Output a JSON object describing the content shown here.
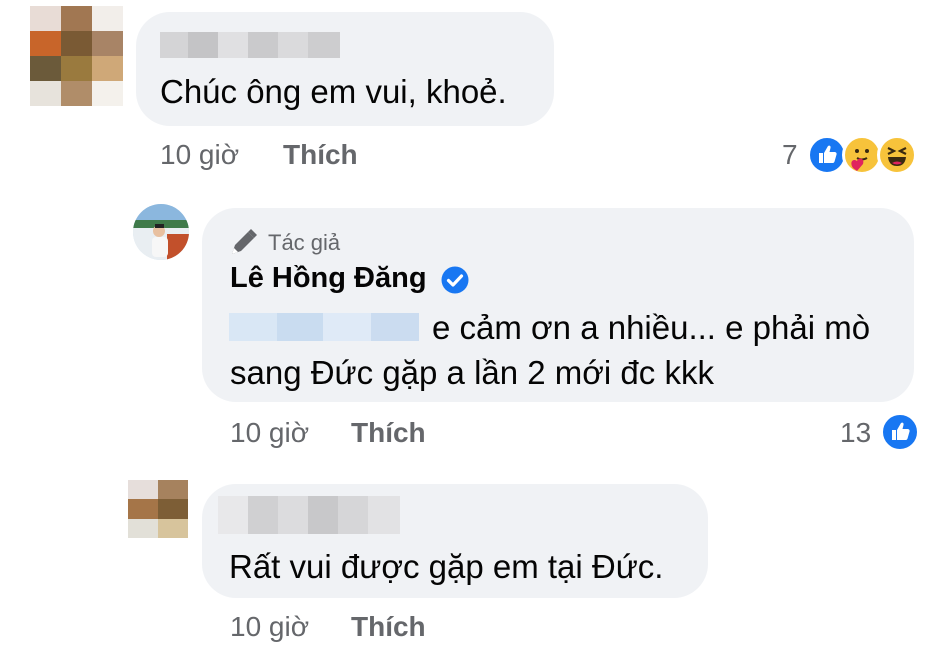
{
  "comments": [
    {
      "text": "Chúc ông em vui, khoẻ.",
      "time": "10 giờ",
      "like_label": "Thích",
      "reaction_count": "7",
      "reactions": [
        "like-icon",
        "care-icon",
        "haha-icon"
      ]
    },
    {
      "badge": "Tác giả",
      "author": "Lê Hồng Đăng",
      "verified": true,
      "text_line1": "e cảm ơn a nhiều... e phải mò",
      "text_line2": "sang Đức gặp a lần 2 mới đc kkk",
      "time": "10 giờ",
      "like_label": "Thích",
      "reaction_count": "13",
      "reactions": [
        "like-icon"
      ]
    },
    {
      "text": "Rất vui được gặp em tại Đức.",
      "time": "10 giờ",
      "like_label": "Thích"
    }
  ],
  "colors": {
    "bubble": "#f0f2f5",
    "meta_text": "#65676b",
    "like_blue": "#1877f2",
    "reaction_yellow": "#f7c33b"
  }
}
